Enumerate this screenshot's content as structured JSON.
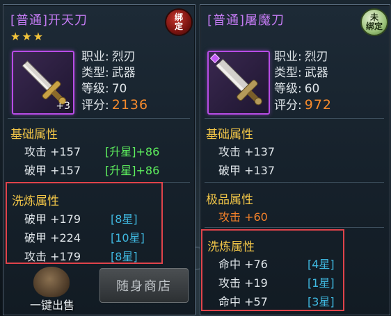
{
  "left_item": {
    "title": "[普通]开天刀",
    "bind_status": "绑定",
    "stars": "★★★",
    "upgrade_level": "+3",
    "info": [
      {
        "label": "职业:",
        "value": "烈刃"
      },
      {
        "label": "类型:",
        "value": "武器"
      },
      {
        "label": "等级:",
        "value": "70"
      },
      {
        "label": "评分:",
        "value": "2136"
      }
    ],
    "base_section": "基础属性",
    "base_attrs": [
      {
        "text": "攻击 +157",
        "extra": "[升星]+86"
      },
      {
        "text": "破甲 +157",
        "extra": "[升星]+86"
      }
    ],
    "refine_section": "洗炼属性",
    "refine_attrs": [
      {
        "text": "破甲 +179",
        "star": "[8星]"
      },
      {
        "text": "破甲 +224",
        "star": "[10星]"
      },
      {
        "text": "攻击 +179",
        "star": "[8星]"
      }
    ]
  },
  "right_item": {
    "title": "[普通]屠魔刀",
    "bind_status": "未绑定",
    "info": [
      {
        "label": "职业:",
        "value": "烈刃"
      },
      {
        "label": "类型:",
        "value": "武器"
      },
      {
        "label": "等级:",
        "value": "60"
      },
      {
        "label": "评分:",
        "value": "972"
      }
    ],
    "base_section": "基础属性",
    "base_attrs": [
      {
        "text": "攻击 +137"
      },
      {
        "text": "破甲 +137"
      }
    ],
    "excellent_section": "极品属性",
    "excellent_attrs": [
      {
        "text": "攻击 +60"
      }
    ],
    "refine_section": "洗炼属性",
    "refine_attrs": [
      {
        "text": "命中 +76",
        "star": "[4星]"
      },
      {
        "text": "攻击 +19",
        "star": "[1星]"
      },
      {
        "text": "命中 +57",
        "star": "[3星]"
      }
    ]
  },
  "buttons": {
    "sell_all": "一键出售",
    "shop": "随身商店"
  },
  "colors": {
    "purple_quality": "#c37bf2",
    "section_gold": "#f2c648",
    "star_bonus_green": "#5ef05e",
    "refine_star_blue": "#3fb8e0",
    "score_orange": "#f58a2c",
    "highlight_red": "#e0434a"
  }
}
